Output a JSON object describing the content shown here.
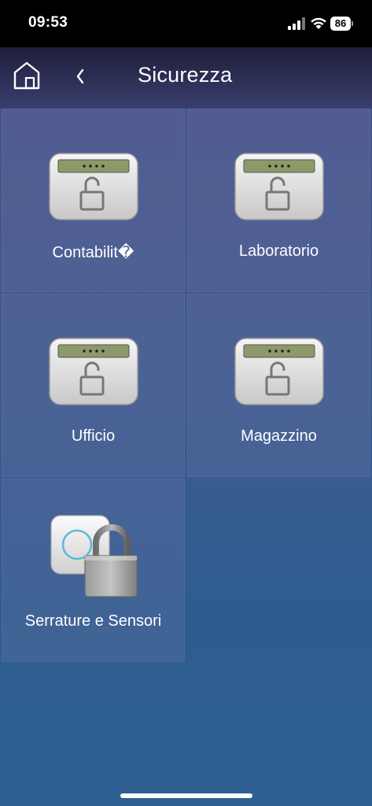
{
  "status_bar": {
    "time": "09:53",
    "battery": "86",
    "icons": [
      "signal-icon",
      "wifi-icon",
      "battery-icon"
    ]
  },
  "header": {
    "title": "Sicurezza",
    "home_icon": "home-icon",
    "back_icon": "chevron-left-icon"
  },
  "tiles": [
    {
      "label": "Contabilit�",
      "icon": "alarm-keypad-unlocked-icon"
    },
    {
      "label": "Laboratorio",
      "icon": "alarm-keypad-unlocked-icon"
    },
    {
      "label": "Ufficio",
      "icon": "alarm-keypad-unlocked-icon"
    },
    {
      "label": "Magazzino",
      "icon": "alarm-keypad-unlocked-icon"
    },
    {
      "label": "Serrature e Sensori",
      "icon": "locks-sensors-padlock-icon"
    }
  ],
  "colors": {
    "background_top": "#4a4f86",
    "background_bottom": "#2c5f90",
    "header": "#2a2c52"
  }
}
